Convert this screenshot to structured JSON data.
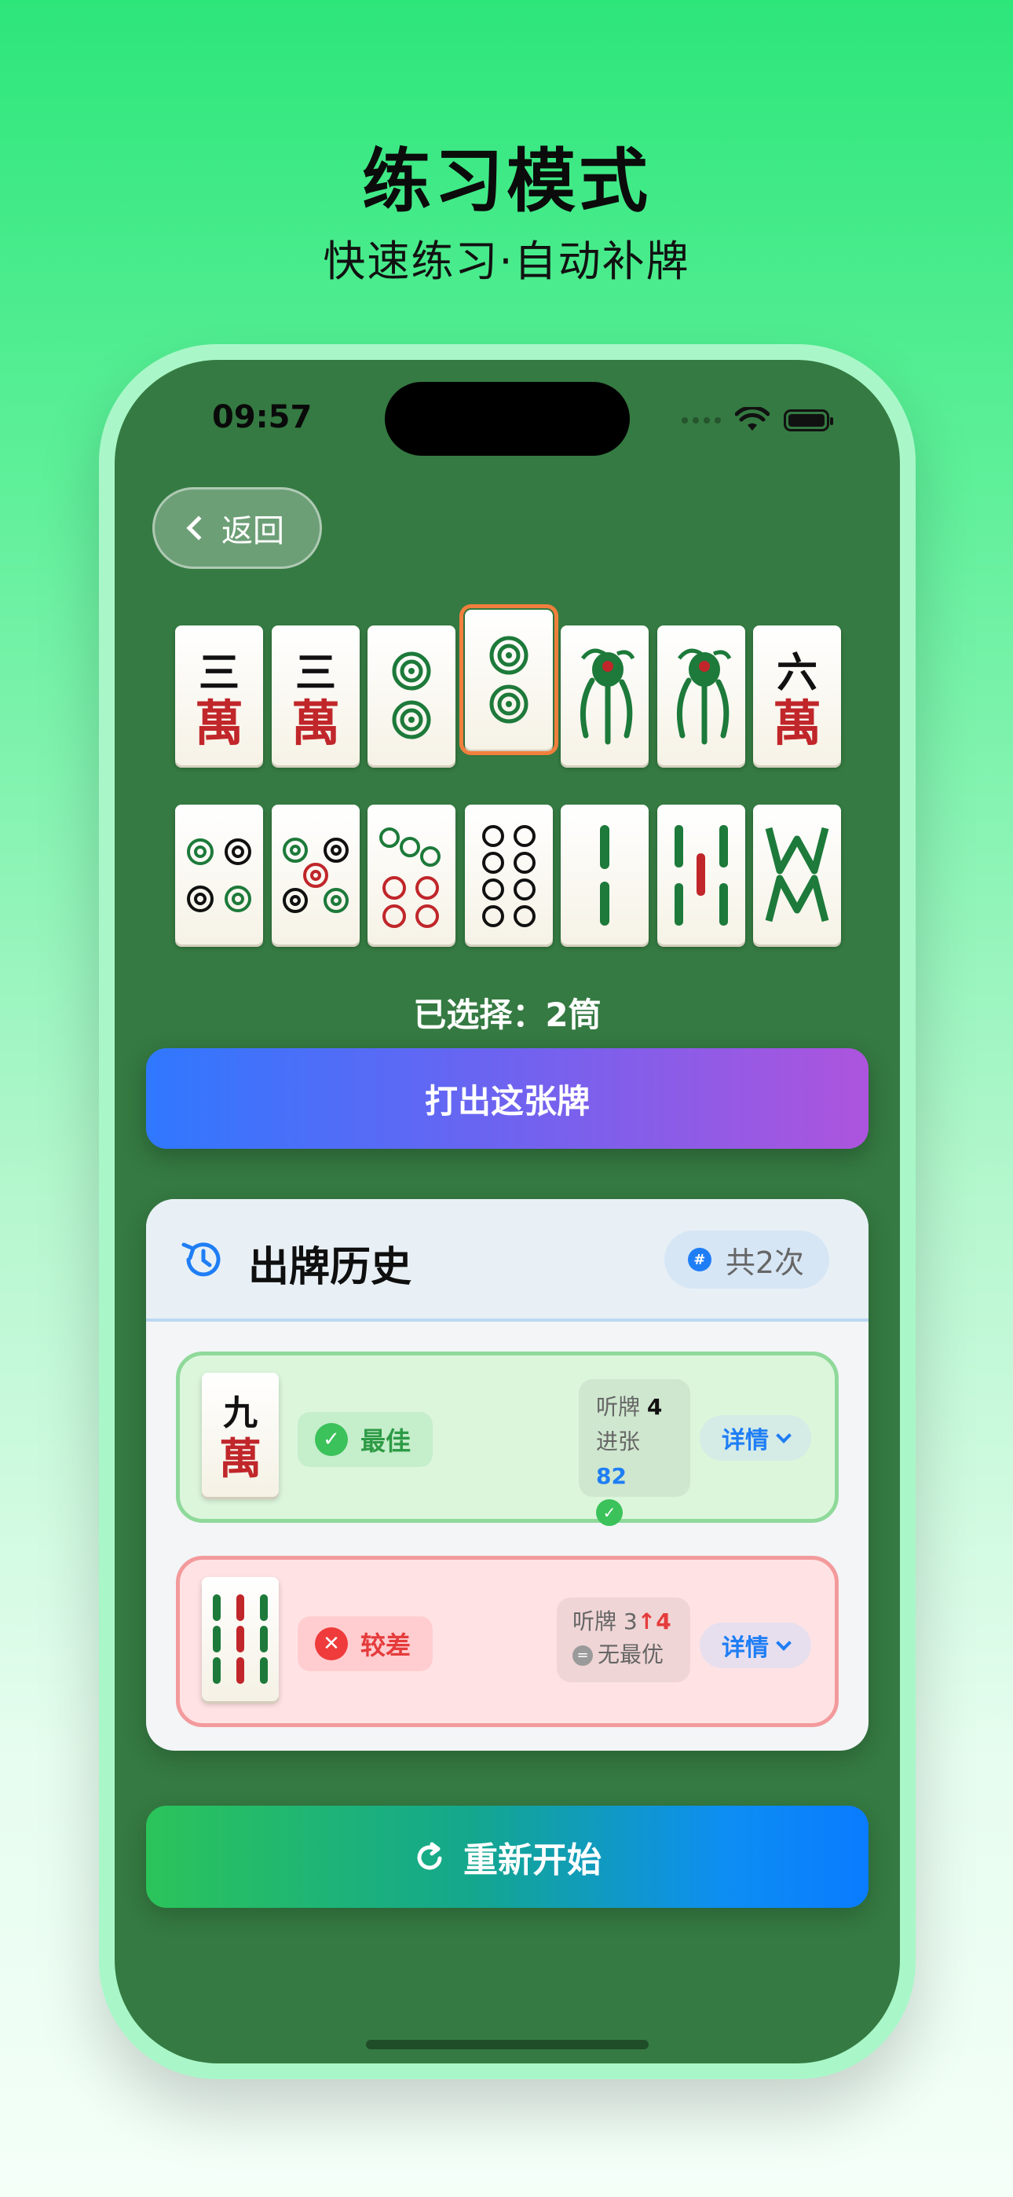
{
  "header": {
    "title": "练习模式",
    "subtitle": "快速练习·自动补牌"
  },
  "status_bar": {
    "time": "09:57"
  },
  "nav": {
    "back_label": "返回"
  },
  "hand": {
    "row1": [
      {
        "name": "3-wan",
        "top": "三",
        "bottom": "萬"
      },
      {
        "name": "3-wan",
        "top": "三",
        "bottom": "萬"
      },
      {
        "name": "2-tong"
      },
      {
        "name": "2-tong",
        "selected": true
      },
      {
        "name": "1-tiao"
      },
      {
        "name": "1-tiao"
      },
      {
        "name": "6-wan",
        "top": "六",
        "bottom": "萬"
      }
    ],
    "row2": [
      {
        "name": "4-tong"
      },
      {
        "name": "5-tong"
      },
      {
        "name": "7-tong"
      },
      {
        "name": "8-tong"
      },
      {
        "name": "2-tiao"
      },
      {
        "name": "5-tiao"
      },
      {
        "name": "8-tiao"
      }
    ]
  },
  "selection": {
    "text": "已选择：2筒"
  },
  "discard": {
    "label": "打出这张牌"
  },
  "history": {
    "title": "出牌历史",
    "count_label": "共2次",
    "count_icon": "#",
    "records": [
      {
        "tile_top": "九",
        "tile_bottom": "萬",
        "verdict": "最佳",
        "listen_label": "听牌",
        "listen_value": "4",
        "accept_label": "进张",
        "accept_value": "82",
        "detail_label": "详情"
      },
      {
        "tile": "9-tiao",
        "verdict": "较差",
        "listen_label": "听牌",
        "listen_value": "3",
        "listen_new": "4",
        "none_label": "无最优",
        "detail_label": "详情"
      }
    ]
  },
  "restart": {
    "label": "重新开始"
  },
  "colors": {
    "felt": "#357a42",
    "selected_outline": "#f27f3d",
    "good": "#3bc25a",
    "bad": "#ef3b3b",
    "accent_blue": "#1f7ef5"
  }
}
